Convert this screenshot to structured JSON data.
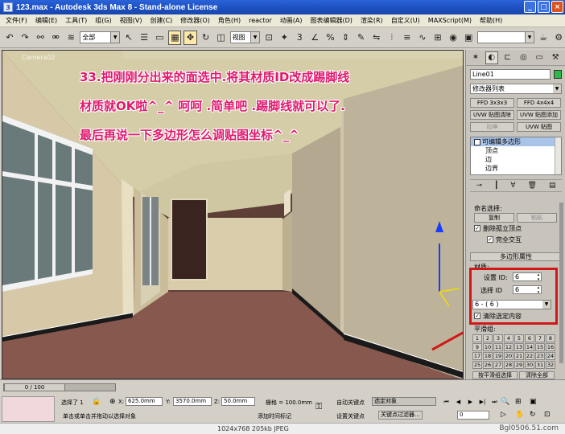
{
  "window": {
    "title": "123.max - Autodesk 3ds Max 8 - Stand-alone License",
    "minimize": "_",
    "maximize": "□",
    "close": "×"
  },
  "menu": [
    "文件(F)",
    "编辑(E)",
    "工具(T)",
    "组(G)",
    "视图(V)",
    "创建(C)",
    "修改器(O)",
    "角色(H)",
    "reactor",
    "动画(A)",
    "图表编辑器(D)",
    "渲染(R)",
    "自定义(U)",
    "MAXScript(M)",
    "帮助(H)"
  ],
  "toolbar": {
    "selection_filter": "全部",
    "coord_system": "视图"
  },
  "viewport": {
    "label": "Camera02",
    "annotations": [
      "33.把刚刚分出来的面选中.将其材质ID改成踢脚线",
      "材质就OK啦^_^   呵呵  .简单吧  .踢脚线就可以了.",
      "最后再说一下多边形怎么调贴图坐标^_^"
    ]
  },
  "command_panel": {
    "object_name": "Line01",
    "object_color": "#2fb84a",
    "modifier_list": "修改器列表",
    "modifier_buttons": [
      "FFD 3x3x3",
      "FFD 4x4x4",
      "UVW 贴图清除",
      "UVW 贴图添加",
      "拉伸",
      "UVW 贴图"
    ],
    "stack": [
      "可编辑多边形",
      "顶点",
      "边",
      "边界"
    ],
    "named_selections": "命名选择:",
    "copy": "复制",
    "paste": "粘贴",
    "delete_isolated": "删除孤立顶点",
    "full_interactivity": "完全交互",
    "rollout_title": "多边形属性",
    "material_label": "材质:",
    "set_id_label": "设置 ID:",
    "set_id_value": "6",
    "select_id_label": "选择 ID",
    "select_id_value": "6",
    "material_select": "6 - ( 6 )",
    "clear_selection": "清除选定内容",
    "smoothing_groups": "平滑组:",
    "smoothing_numbers": [
      "1",
      "2",
      "3",
      "4",
      "5",
      "6",
      "7",
      "8",
      "9",
      "10",
      "11",
      "12",
      "13",
      "14",
      "15",
      "16",
      "17",
      "18",
      "19",
      "20",
      "21",
      "22",
      "23",
      "24",
      "25",
      "26",
      "27",
      "28",
      "29",
      "30",
      "31",
      "32"
    ],
    "select_by_sg": "按平滑组选择",
    "clear_all": "清除全部"
  },
  "status": {
    "time_slider": "0 / 100",
    "selected": "选择了 1",
    "x_label": "X:",
    "x_value": "625.0mm",
    "y_label": "Y:",
    "y_value": "3570.0mm",
    "z_label": "Z:",
    "z_value": "50.0mm",
    "grid": "栅格 = 100.0mm",
    "auto_key": "自动关键点",
    "set_key": "设置关键点",
    "key_mode": "选定对象",
    "key_filters": "关键点过滤器...",
    "frame": "0",
    "prompt": "单击或单击并拖动以选择对象",
    "add_time_tag": "添加时间标记"
  },
  "footer": {
    "info": "1024x768  205kb  JPEG",
    "site": "Bgl0506.51.com"
  }
}
